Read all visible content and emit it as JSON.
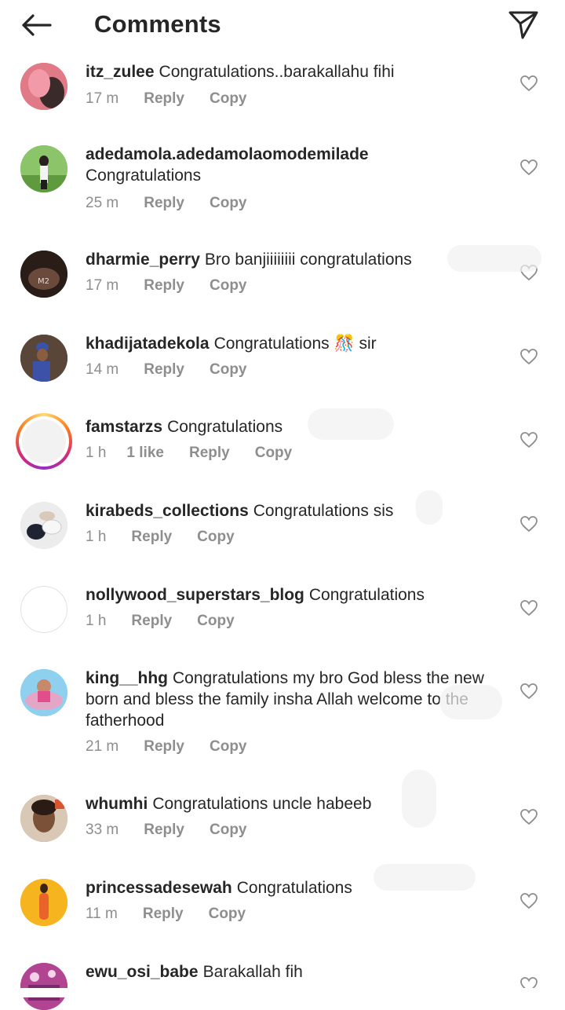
{
  "header": {
    "title": "Comments",
    "back_icon": "arrow-left-icon",
    "share_icon": "paper-plane-icon"
  },
  "colors": {
    "text": "#262626",
    "meta": "#8e8e8e",
    "story_ring": [
      "#feda75",
      "#fa7e1e",
      "#d62976",
      "#962fbf"
    ]
  },
  "comments": [
    {
      "username": "itz_zulee",
      "text": "Congratulations..barakallahu fihi",
      "time": "17 m",
      "likes": "",
      "reply": "Reply",
      "copy": "Copy",
      "avatar_color": "#e06a7a"
    },
    {
      "username": "adedamola.adedamolaomodemilade",
      "text": "Congratulations",
      "time": "25 m",
      "likes": "",
      "reply": "Reply",
      "copy": "Copy",
      "avatar_color": "#6fae4e"
    },
    {
      "username": "dharmie_perry",
      "text": "Bro banjiiiiiiii congratulations",
      "time": "17 m",
      "likes": "",
      "reply": "Reply",
      "copy": "Copy",
      "avatar_color": "#3a2a24"
    },
    {
      "username": "khadijatadekola",
      "text": "Congratulations 🎊 sir",
      "time": "14 m",
      "likes": "",
      "reply": "Reply",
      "copy": "Copy",
      "avatar_color": "#4a3b35"
    },
    {
      "username": "famstarzs",
      "text": "Congratulations",
      "time": "1 h",
      "likes": "1 like",
      "reply": "Reply",
      "copy": "Copy",
      "avatar_color": "#f2f2f2"
    },
    {
      "username": "kirabeds_collections",
      "text": "Congratulations sis",
      "time": "1 h",
      "likes": "",
      "reply": "Reply",
      "copy": "Copy",
      "avatar_color": "#cfcfcf"
    },
    {
      "username": "nollywood_superstars_blog",
      "text": "Congratulations",
      "time": "1 h",
      "likes": "",
      "reply": "Reply",
      "copy": "Copy",
      "avatar_color": "#ffffff"
    },
    {
      "username": "king__hhg",
      "text": "Congratulations my bro God bless the new born and bless the family insha Allah welcome to the fatherhood",
      "time": "21 m",
      "likes": "",
      "reply": "Reply",
      "copy": "Copy",
      "avatar_color": "#7cc4e8"
    },
    {
      "username": "whumhi",
      "text": "Congratulations uncle habeeb",
      "time": "33 m",
      "likes": "",
      "reply": "Reply",
      "copy": "Copy",
      "avatar_color": "#a8876b"
    },
    {
      "username": "princessadesewah",
      "text": "Congratulations",
      "time": "11 m",
      "likes": "",
      "reply": "Reply",
      "copy": "Copy",
      "avatar_color": "#f3b21b"
    },
    {
      "username": "ewu_osi_babe",
      "text": "Barakallah fih",
      "time": "",
      "likes": "",
      "reply": "",
      "copy": "",
      "avatar_color": "#c04a9b"
    }
  ]
}
